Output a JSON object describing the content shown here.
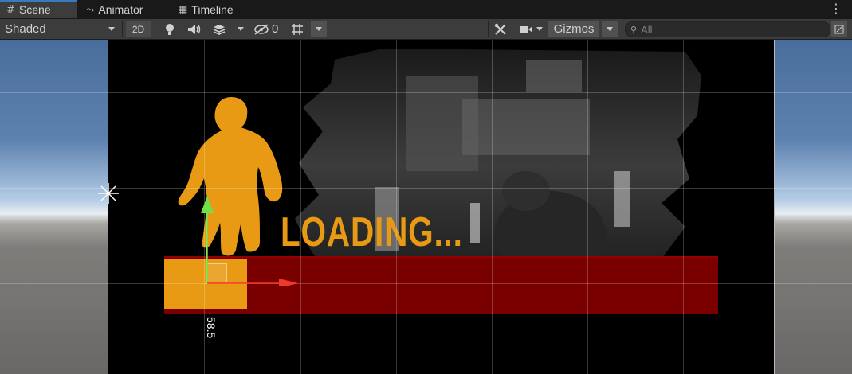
{
  "tabs": [
    {
      "label": "Scene",
      "icon": "grid-icon",
      "active": true
    },
    {
      "label": "Animator",
      "icon": "animator-icon",
      "active": false
    },
    {
      "label": "Timeline",
      "icon": "timeline-icon",
      "active": false
    }
  ],
  "toolbar": {
    "shading_mode": "Shaded",
    "mode_2d": "2D",
    "hidden_count": "0",
    "gizmos_label": "Gizmos",
    "search_placeholder": "All"
  },
  "scene": {
    "loading_text": "LOADING...",
    "gizmo_value": "58.5",
    "progress": 0.15,
    "colors": {
      "accent": "#e89a14",
      "bar": "#7a0000",
      "canvas": "#000000",
      "tab_highlight": "#3a79bb"
    }
  }
}
